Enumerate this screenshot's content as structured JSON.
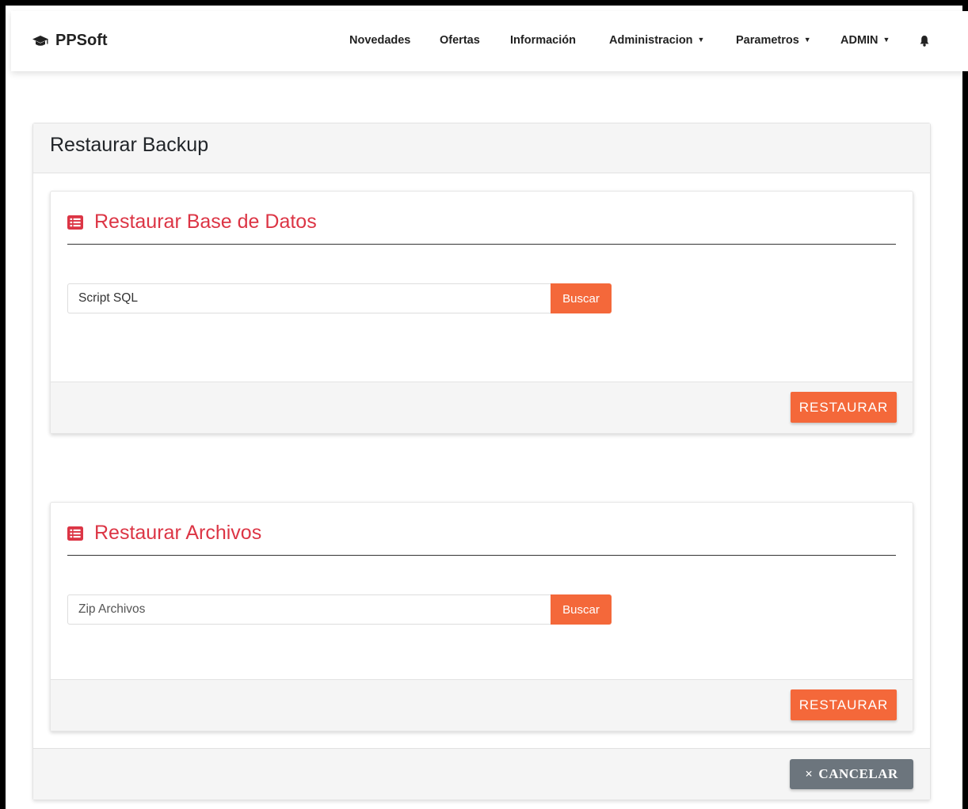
{
  "navbar": {
    "brand": "PPSoft",
    "brand_icon": "graduation-cap-icon",
    "items": [
      {
        "label": "Novedades",
        "dropdown": false
      },
      {
        "label": "Ofertas",
        "dropdown": false
      },
      {
        "label": "Información",
        "dropdown": false
      },
      {
        "label": "Administracion",
        "dropdown": true
      },
      {
        "label": "Parametros",
        "dropdown": true
      },
      {
        "label": "ADMIN",
        "dropdown": true
      }
    ],
    "caret": "▼",
    "bell_icon": "bell-icon"
  },
  "page": {
    "title": "Restaurar Backup"
  },
  "database_section": {
    "title": "Restaurar Base de Datos",
    "icon": "list-alt-icon",
    "input_placeholder": "Script SQL",
    "browse_label": "Buscar",
    "submit_label": "RESTAURAR"
  },
  "files_section": {
    "title": "Restaurar Archivos",
    "icon": "list-alt-icon",
    "input_placeholder": "Zip Archivos",
    "browse_label": "Buscar",
    "submit_label": "RESTAURAR"
  },
  "footer": {
    "cancel_icon": "×",
    "cancel_label": "CANCELAR"
  },
  "colors": {
    "accent": "#f4683a",
    "section_title": "#dc3545",
    "cancel_button": "#6c757d"
  }
}
